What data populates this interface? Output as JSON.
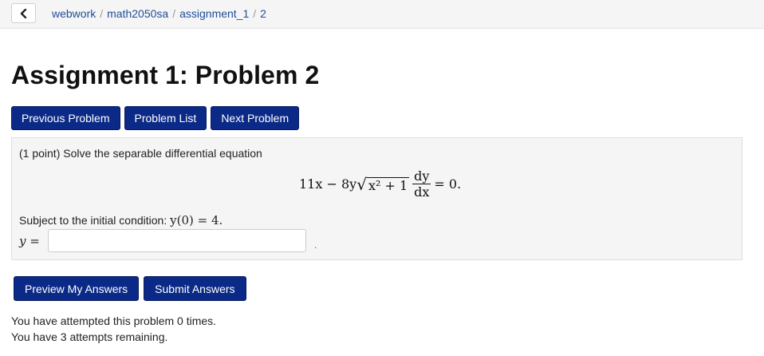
{
  "breadcrumb": {
    "back_icon": "chevron-left-icon",
    "items": [
      "webwork",
      "math2050sa",
      "assignment_1"
    ],
    "current": "2"
  },
  "title": "Assignment 1: Problem 2",
  "nav": {
    "previous": "Previous Problem",
    "list": "Problem List",
    "next": "Next Problem"
  },
  "problem": {
    "intro": "(1 point) Solve the separable differential equation",
    "equation": {
      "lhs_terms": "11x − 8y",
      "radicand": "x² + 1",
      "numerator": "dy",
      "denominator": "dx",
      "rhs": "= 0."
    },
    "condition_text": "Subject to the initial condition: ",
    "condition_math": "y(0) = 4.",
    "answer_label": "y =",
    "answer_value": "",
    "answer_suffix": "."
  },
  "actions": {
    "preview": "Preview My Answers",
    "submit": "Submit Answers"
  },
  "attempts": {
    "line1": "You have attempted this problem 0 times.",
    "line2": "You have 3 attempts remaining."
  },
  "colors": {
    "button_bg": "#0b2a87",
    "link": "#1f4e99",
    "panel_bg": "#f5f5f5"
  }
}
